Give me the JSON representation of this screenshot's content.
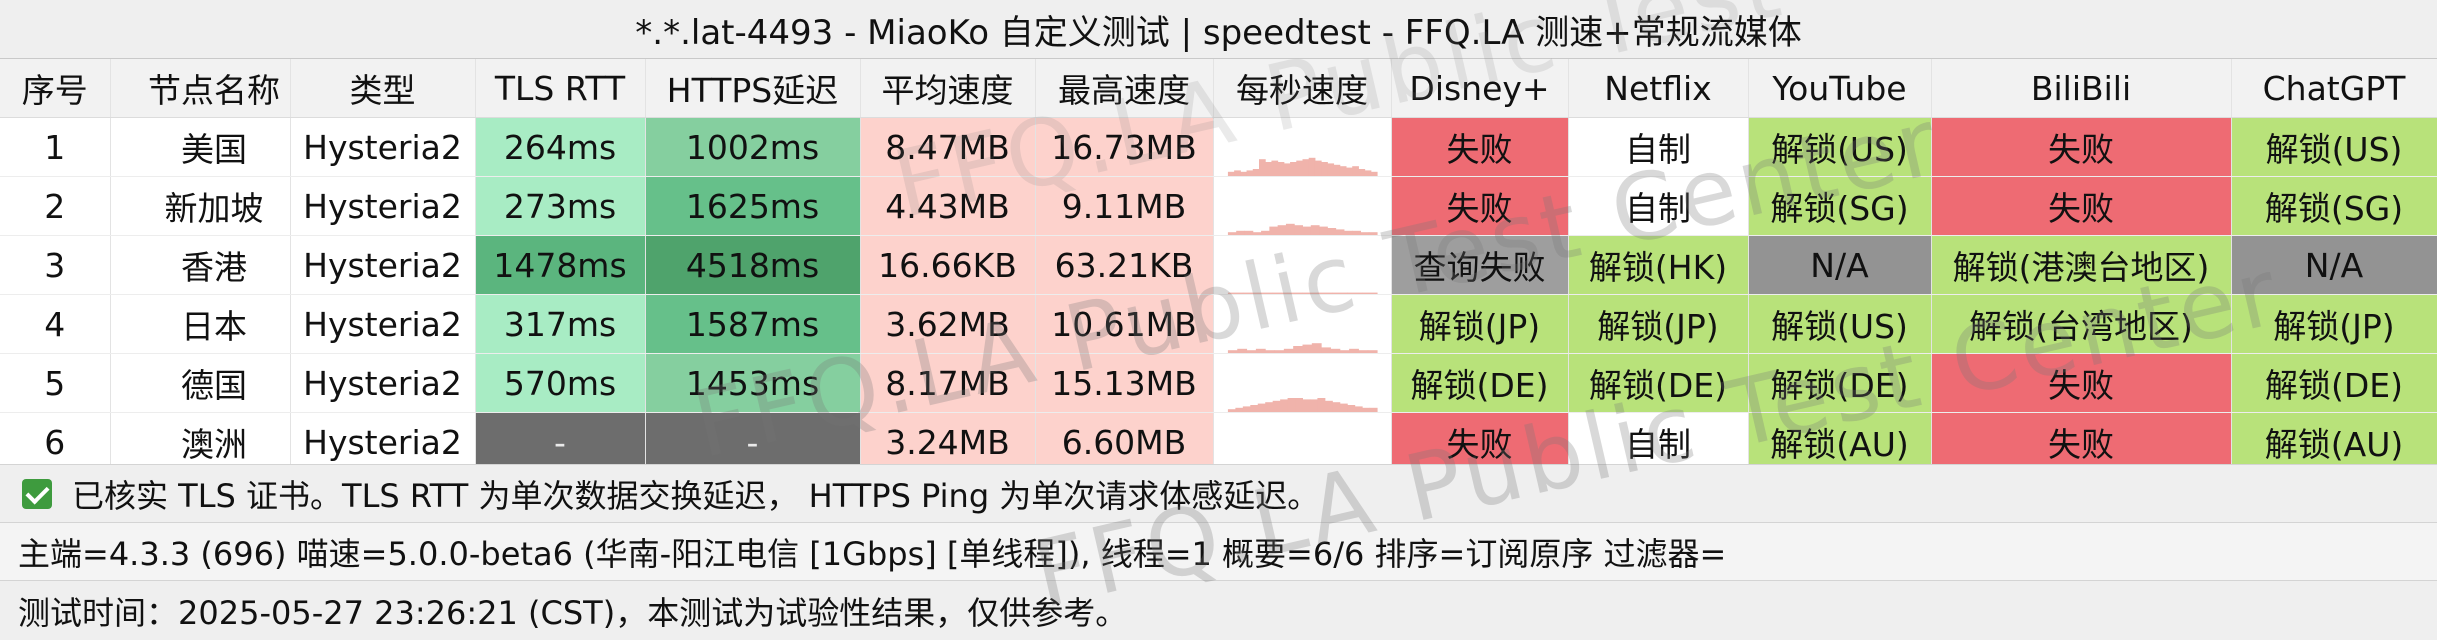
{
  "title": "*.*.lat-4493 - MiaoKo 自定义测试 | speedtest - FFQ.LA 测速+常规流媒体",
  "headers": [
    "序号",
    "节点名称",
    "类型",
    "TLS RTT",
    "HTTPS延迟",
    "平均速度",
    "最高速度",
    "每秒速度",
    "Disney+",
    "Netflix",
    "YouTube",
    "BiliBili",
    "ChatGPT"
  ],
  "rows": [
    {
      "idx": "1",
      "name": "美国",
      "type": "Hysteria2",
      "tls": "264ms",
      "https": "1002ms",
      "avg": "8.47MB",
      "max": "16.73MB",
      "disney": "失败",
      "netflix": "自制",
      "youtube": "解锁(US)",
      "bilibili": "失败",
      "chatgpt": "解锁(US)"
    },
    {
      "idx": "2",
      "name": "新加坡",
      "type": "Hysteria2",
      "tls": "273ms",
      "https": "1625ms",
      "avg": "4.43MB",
      "max": "9.11MB",
      "disney": "失败",
      "netflix": "自制",
      "youtube": "解锁(SG)",
      "bilibili": "失败",
      "chatgpt": "解锁(SG)"
    },
    {
      "idx": "3",
      "name": "香港",
      "type": "Hysteria2",
      "tls": "1478ms",
      "https": "4518ms",
      "avg": "16.66KB",
      "max": "63.21KB",
      "disney": "查询失败",
      "netflix": "解锁(HK)",
      "youtube": "N/A",
      "bilibili": "解锁(港澳台地区)",
      "chatgpt": "N/A"
    },
    {
      "idx": "4",
      "name": "日本",
      "type": "Hysteria2",
      "tls": "317ms",
      "https": "1587ms",
      "avg": "3.62MB",
      "max": "10.61MB",
      "disney": "解锁(JP)",
      "netflix": "解锁(JP)",
      "youtube": "解锁(US)",
      "bilibili": "解锁(台湾地区)",
      "chatgpt": "解锁(JP)"
    },
    {
      "idx": "5",
      "name": "德国",
      "type": "Hysteria2",
      "tls": "570ms",
      "https": "1453ms",
      "avg": "8.17MB",
      "max": "15.13MB",
      "disney": "解锁(DE)",
      "netflix": "解锁(DE)",
      "youtube": "解锁(DE)",
      "bilibili": "失败",
      "chatgpt": "解锁(DE)"
    },
    {
      "idx": "6",
      "name": "澳洲",
      "type": "Hysteria2",
      "tls": "-",
      "https": "-",
      "avg": "3.24MB",
      "max": "6.60MB",
      "disney": "失败",
      "netflix": "自制",
      "youtube": "解锁(AU)",
      "bilibili": "失败",
      "chatgpt": "解锁(AU)"
    }
  ],
  "colors": {
    "fail": "#ee6b73",
    "unlock": "#b8e27a",
    "na": "#939393",
    "queryfail": "#9e9e9e",
    "none": "#ffffff",
    "dash": "#6d6d6d",
    "speed": "#fdd2cc",
    "spark": "#f0b3ab"
  },
  "footer": {
    "note": "已核实 TLS 证书。TLS RTT 为单次数据交换延迟， HTTPS Ping 为单次请求体感延迟。",
    "info": "主端=4.3.3 (696) 喵速=5.0.0-beta6 (华南-阳江电信 [1Gbps] [单线程]), 线程=1 概要=6/6 排序=订阅原序 过滤器=",
    "time": "测试时间：2025-05-27 23:26:21 (CST)，本测试为试验性结果，仅供参考。"
  },
  "watermark": [
    "FFQ.LA Public Test Center",
    "FFQ.LA Public Test Center",
    "FFQ.LA Public Test Center"
  ]
}
